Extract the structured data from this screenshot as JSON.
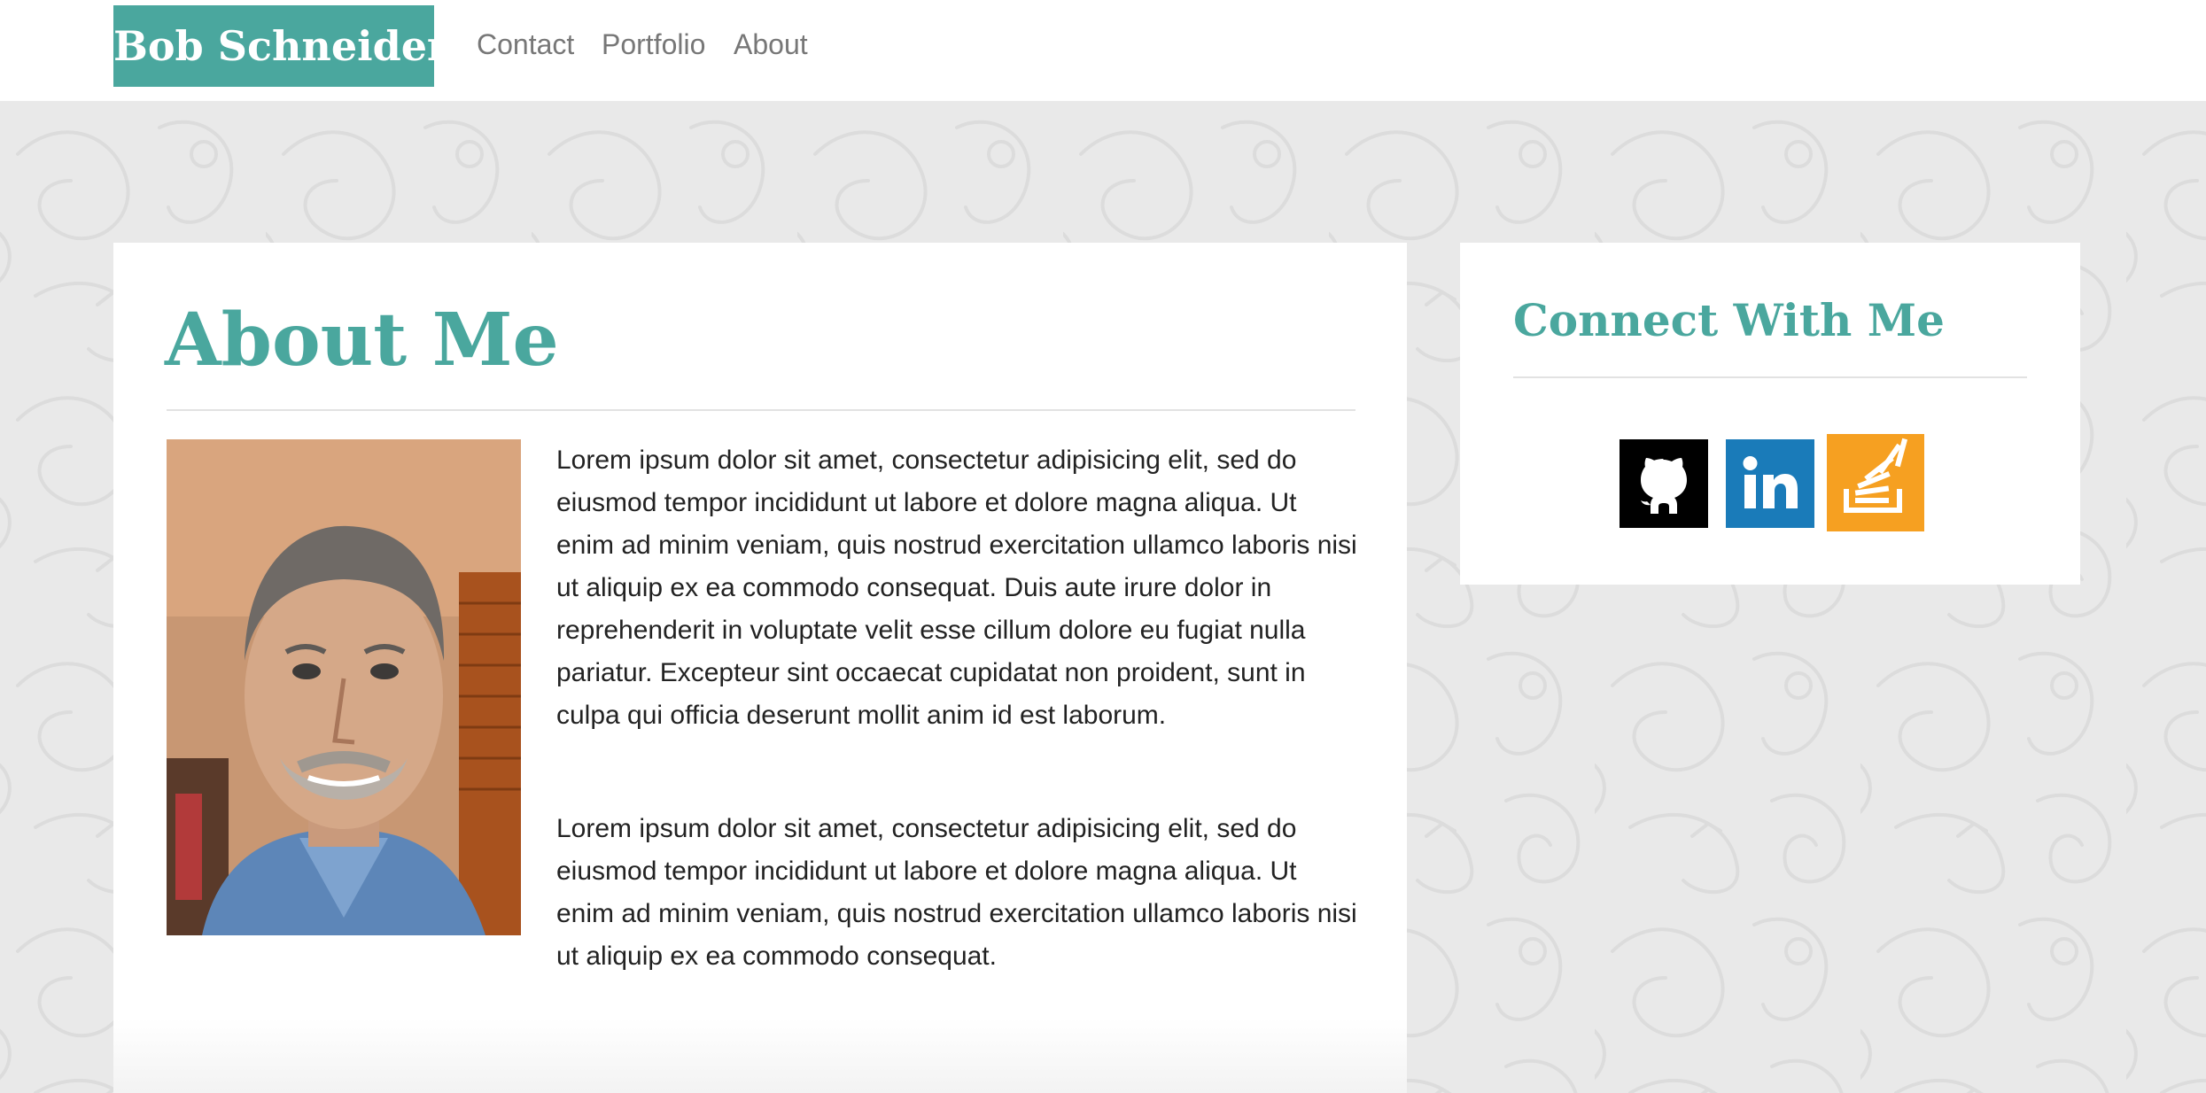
{
  "navbar": {
    "brand": "Bob Schneider",
    "links": [
      {
        "label": "Contact"
      },
      {
        "label": "Portfolio"
      },
      {
        "label": "About"
      }
    ]
  },
  "main": {
    "title": "About Me",
    "paragraphs": [
      "Lorem ipsum dolor sit amet, consectetur adipisicing elit, sed do eiusmod tempor incididunt ut labore et dolore magna aliqua. Ut enim ad minim veniam, quis nostrud exercitation ullamco laboris nisi ut aliquip ex ea commodo consequat. Duis aute irure dolor in reprehenderit in voluptate velit esse cillum dolore eu fugiat nulla pariatur. Excepteur sint occaecat cupidatat non proident, sunt in culpa qui officia deserunt mollit anim id est laborum.",
      "Lorem ipsum dolor sit amet, consectetur adipisicing elit, sed do eiusmod tempor incididunt ut labore et dolore magna aliqua. Ut enim ad minim veniam, quis nostrud exercitation ullamco laboris nisi ut aliquip ex ea commodo consequat."
    ]
  },
  "sidebar": {
    "title": "Connect With Me",
    "social": [
      {
        "icon": "github-icon",
        "color": "#000000"
      },
      {
        "icon": "linkedin-icon",
        "color": "#1a7bb9"
      },
      {
        "icon": "stackoverflow-icon",
        "color": "#f6a021"
      }
    ]
  },
  "colors": {
    "accent": "#4aa79e",
    "background": "#e9e9e9",
    "nav_text": "#777777",
    "body_text": "#222222"
  }
}
